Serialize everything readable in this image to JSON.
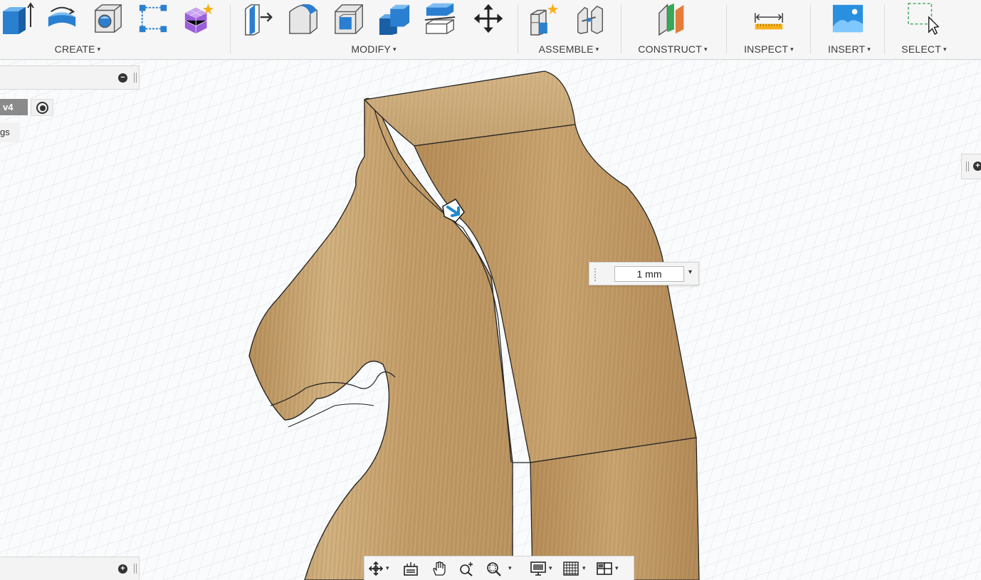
{
  "toolbar": {
    "groups": [
      {
        "id": "create",
        "label": "CREATE",
        "icons": [
          "extrude-icon",
          "revolve-icon",
          "hole-icon",
          "sketch-pattern-icon",
          "create-form-icon"
        ]
      },
      {
        "id": "modify",
        "label": "MODIFY",
        "icons": [
          "press-pull-icon",
          "fillet-icon",
          "shell-icon",
          "combine-icon",
          "split-body-icon",
          "move-icon"
        ]
      },
      {
        "id": "assemble",
        "label": "ASSEMBLE",
        "icons": [
          "new-component-icon",
          "joint-icon"
        ]
      },
      {
        "id": "construct",
        "label": "CONSTRUCT",
        "icons": [
          "plane-icon"
        ]
      },
      {
        "id": "inspect",
        "label": "INSPECT",
        "icons": [
          "measure-icon"
        ]
      },
      {
        "id": "insert",
        "label": "INSERT",
        "icons": [
          "insert-image-icon"
        ]
      },
      {
        "id": "select",
        "label": "SELECT",
        "icons": [
          "window-select-icon"
        ]
      }
    ],
    "caret": "▾"
  },
  "browser": {
    "collapse_symbol": "−",
    "document_version": "v4",
    "settings_fragment": "gs"
  },
  "comments": {
    "add_symbol": "+"
  },
  "right_panel": {
    "add_symbol": "+"
  },
  "dimension": {
    "value": "1 mm",
    "caret": "▾"
  },
  "navbar": {
    "items": [
      "orbit-icon",
      "look-at-icon",
      "pan-icon",
      "zoom-icon",
      "fit-icon",
      "display-settings-icon",
      "grid-settings-icon",
      "viewports-icon"
    ],
    "caret": "▾"
  },
  "colors": {
    "wood": "#c8a674",
    "wood_dark": "#9c7a4c",
    "accent_blue": "#1e88d2",
    "grid": "#d9dde2"
  }
}
